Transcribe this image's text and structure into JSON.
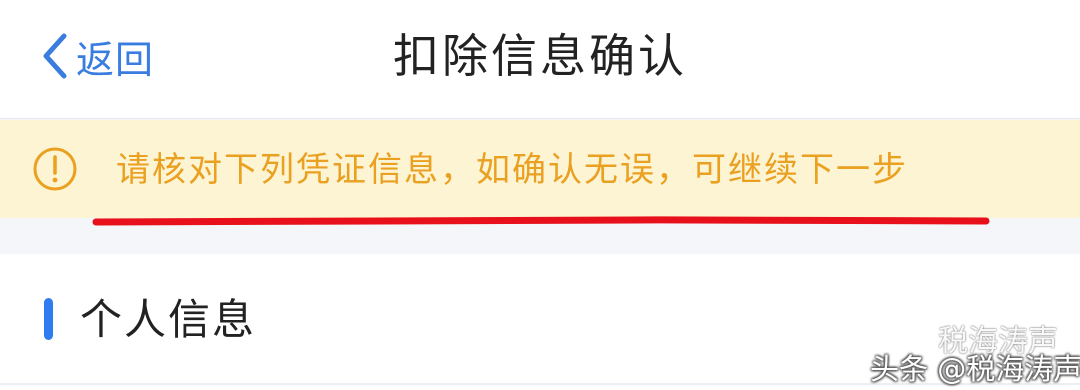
{
  "header": {
    "back_label": "返回",
    "title": "扣除信息确认"
  },
  "notice": {
    "icon": "exclamation-circle-icon",
    "text": "请核对下列凭证信息，如确认无误，可继续下一步",
    "text_color": "#eaa020",
    "background": "#fdf4d3",
    "annotation_color": "#e8101a"
  },
  "section": {
    "title": "个人信息",
    "accent_color": "#2f7bf0"
  },
  "watermark": {
    "top": "税海涛声",
    "bottom": "头条 @税海涛声"
  }
}
